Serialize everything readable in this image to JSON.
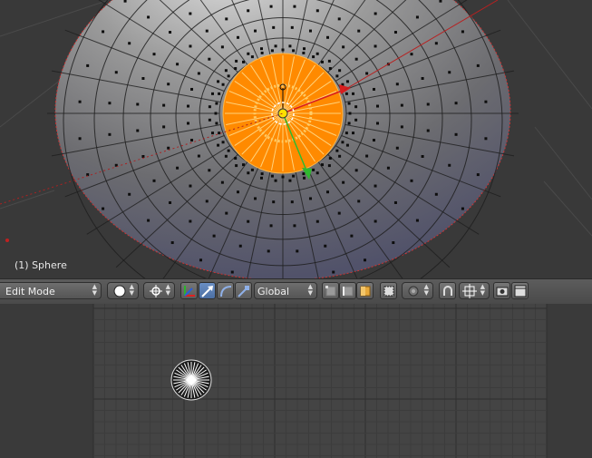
{
  "viewport": {
    "object_label": "(1) Sphere"
  },
  "toolbar": {
    "mode": "Edit Mode",
    "orientation": "Global",
    "icons": [
      "editor-type-icon",
      "viewport-shading-icon",
      "pivot-point-icon",
      "manipulator-icon",
      "translate-icon",
      "rotate-icon",
      "scale-icon",
      "vertex-select-icon",
      "edge-select-icon",
      "face-select-icon",
      "limit-selection-icon",
      "proportional-edit-icon",
      "snap-icon",
      "snap-target-icon",
      "render-icon",
      "render-animation-icon"
    ]
  },
  "colors": {
    "selection": "#ff8a00",
    "active_object": "#e8b000",
    "x_axis": "#d81e1e",
    "y_axis": "#2fb82f",
    "background": "#393939"
  }
}
